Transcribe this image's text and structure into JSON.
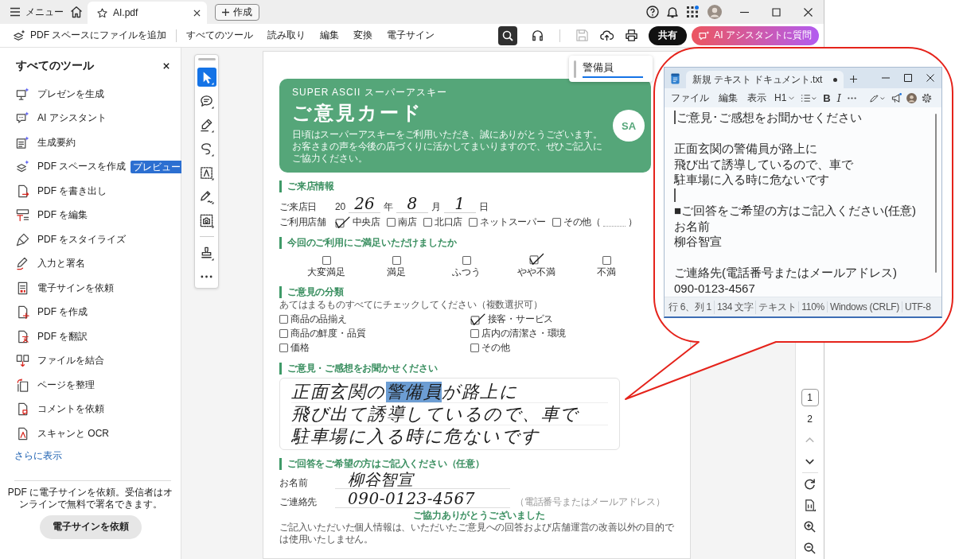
{
  "titlebar": {
    "menu": "メニュー",
    "tabs": [
      {
        "label": "AI.pdf",
        "selected": true
      }
    ],
    "create": "作成"
  },
  "toolbar": {
    "add_to_space": "PDF スペースにファイルを追加",
    "nav": [
      "すべてのツール",
      "読み取り",
      "編集",
      "変換",
      "電子サイン"
    ],
    "search_selected": true,
    "save_disabled": true,
    "share": "共有",
    "ai_assistant": "AI アシスタントに質問"
  },
  "sidebar": {
    "title": "すべてのツール",
    "tools": [
      {
        "label": "プレゼンを生成"
      },
      {
        "label": "AI アシスタント"
      },
      {
        "label": "生成要約"
      },
      {
        "label": "PDF スペースを作成",
        "badge": "プレビュー"
      },
      {
        "label": "PDF を書き出し"
      },
      {
        "label": "PDF を編集"
      },
      {
        "label": "PDF をスタイライズ"
      },
      {
        "label": "入力と署名"
      },
      {
        "label": "電子サインを依頼"
      },
      {
        "label": "PDF を作成"
      },
      {
        "label": "PDF を翻訳"
      },
      {
        "label": "ファイルを結合"
      },
      {
        "label": "ページを整理"
      },
      {
        "label": "コメントを依頼"
      },
      {
        "label": "スキャンと OCR"
      }
    ],
    "more": "さらに表示",
    "promo": "PDF に電子サインを依頼。受信者はオンラインで無料で署名できます。",
    "promo_button": "電子サインを依頼"
  },
  "tool_rail": [
    {
      "selected": true
    },
    {
      "selected": false
    },
    {
      "selected": false
    },
    {
      "selected": false
    },
    {
      "selected": false
    },
    {
      "selected": false
    },
    {
      "selected": false
    },
    {
      "selected": false
    }
  ],
  "find": {
    "value": "警備員"
  },
  "form": {
    "brand": "SUPER ASCII スーパーアスキー",
    "title": "ご意見カード",
    "intro": [
      "日頃はスーパーアスキーをご利用いただき、誠にありがとうございます。",
      "お客さまの声を今後の店づくりに活かしてまいりますので、ぜひご記入にご協力ください。"
    ],
    "logo": "SA",
    "visit": {
      "heading": "ご来店情報",
      "date_label": "ご来店日",
      "year_prefix": "20",
      "date": [
        {
          "value": "26",
          "unit": "年"
        },
        {
          "value": "8",
          "unit": "月"
        },
        {
          "value": "1",
          "unit": "日"
        }
      ],
      "store_label": "ご利用店舗",
      "stores": [
        {
          "kind": "option",
          "label": "中央店",
          "checked": true
        },
        {
          "kind": "option",
          "label": "南店",
          "checked": false
        },
        {
          "kind": "option",
          "label": "北口店",
          "checked": false
        },
        {
          "kind": "option",
          "label": "ネットスーパー",
          "checked": false
        },
        {
          "kind": "other",
          "label": "その他（",
          "close": "）",
          "checked": false
        }
      ]
    },
    "satisfaction": {
      "heading": "今回のご利用にご満足いただけましたか",
      "options": [
        {
          "label": "大変満足",
          "checked": false
        },
        {
          "label": "満足",
          "checked": false
        },
        {
          "label": "ふつう",
          "checked": false
        },
        {
          "label": "やや不満",
          "checked": true
        },
        {
          "label": "不満",
          "checked": false
        }
      ]
    },
    "categories": {
      "heading": "ご意見の分類",
      "hint": "あてはまるものすべてにチェックしてください（複数選択可）",
      "options": [
        {
          "label": "商品の品揃え",
          "checked": false
        },
        {
          "label": "接客・サービス",
          "checked": true
        },
        {
          "label": "商品の鮮度・品質",
          "checked": false
        },
        {
          "label": "店内の清潔さ・環境",
          "checked": false
        },
        {
          "label": "価格",
          "checked": false
        },
        {
          "label": "その他",
          "checked": false
        }
      ]
    },
    "comments": {
      "heading": "ご意見・ご感想をお聞かせください",
      "lines": [
        [
          {
            "text": "正面玄関の",
            "highlighted": false
          },
          {
            "text": "警備員",
            "highlighted": true
          },
          {
            "text": "が路上に",
            "highlighted": false
          }
        ],
        [
          {
            "text": "飛び出て誘導しているので、車で",
            "highlighted": false
          }
        ],
        [
          {
            "text": "駐車場に入る時に危ないです",
            "highlighted": false
          }
        ]
      ]
    },
    "contact": {
      "heading": "ご回答をご希望の方はご記入ください（任意）",
      "fields": [
        {
          "label": "お名前",
          "value": "柳谷智宣"
        },
        {
          "label": "ご連絡先",
          "value": "090-0123-4567",
          "note": "（電話番号またはメールアドレス）"
        }
      ],
      "thanks": "ご協力ありがとうございました",
      "notice": "ご記入いただいた個人情報は、いただいたご意見への回答および店舗運営の改善以外の目的では使用いたしません。"
    }
  },
  "page_nav": {
    "pages": [
      {
        "label": "1",
        "selected": true
      },
      {
        "label": "2",
        "selected": false
      }
    ],
    "previous_disabled": true
  },
  "notepad": {
    "tab": "新規 テキスト ドキュメント.txt",
    "modified": true,
    "menus": [
      "ファイル",
      "編集",
      "表示"
    ],
    "heading": "H1",
    "format": [
      {
        "kind": "bold",
        "label": "B"
      },
      {
        "kind": "italic",
        "label": "I"
      }
    ],
    "lines": [
      {
        "kind": "text",
        "text": "ご意見･ご感想をお聞かせください",
        "caret": true
      },
      {
        "kind": "blank",
        "caret": false
      },
      {
        "kind": "text",
        "text": "正面玄関の警備員が路上に",
        "caret": false
      },
      {
        "kind": "text",
        "text": "飛び出て誘導しているので、車で",
        "caret": false
      },
      {
        "kind": "text",
        "text": "駐車場に入る時に危ないです",
        "caret": false
      },
      {
        "kind": "blank",
        "caret": true
      },
      {
        "kind": "text",
        "text": "■ご回答をご希望の方はご記入ください(任意)",
        "caret": false
      },
      {
        "kind": "text",
        "text": "お名前",
        "caret": false
      },
      {
        "kind": "text",
        "text": "柳谷智宣",
        "caret": false
      },
      {
        "kind": "blank",
        "caret": false
      },
      {
        "kind": "text",
        "text": "ご連絡先(電話番号またはメールアドレス)",
        "caret": false
      },
      {
        "kind": "text",
        "text": "090-0123-4567",
        "caret": false
      }
    ],
    "status": [
      "行 6、列 1",
      "134 文字",
      "テキスト",
      "110%",
      "Windows (CRLF)",
      "UTF-8"
    ]
  }
}
